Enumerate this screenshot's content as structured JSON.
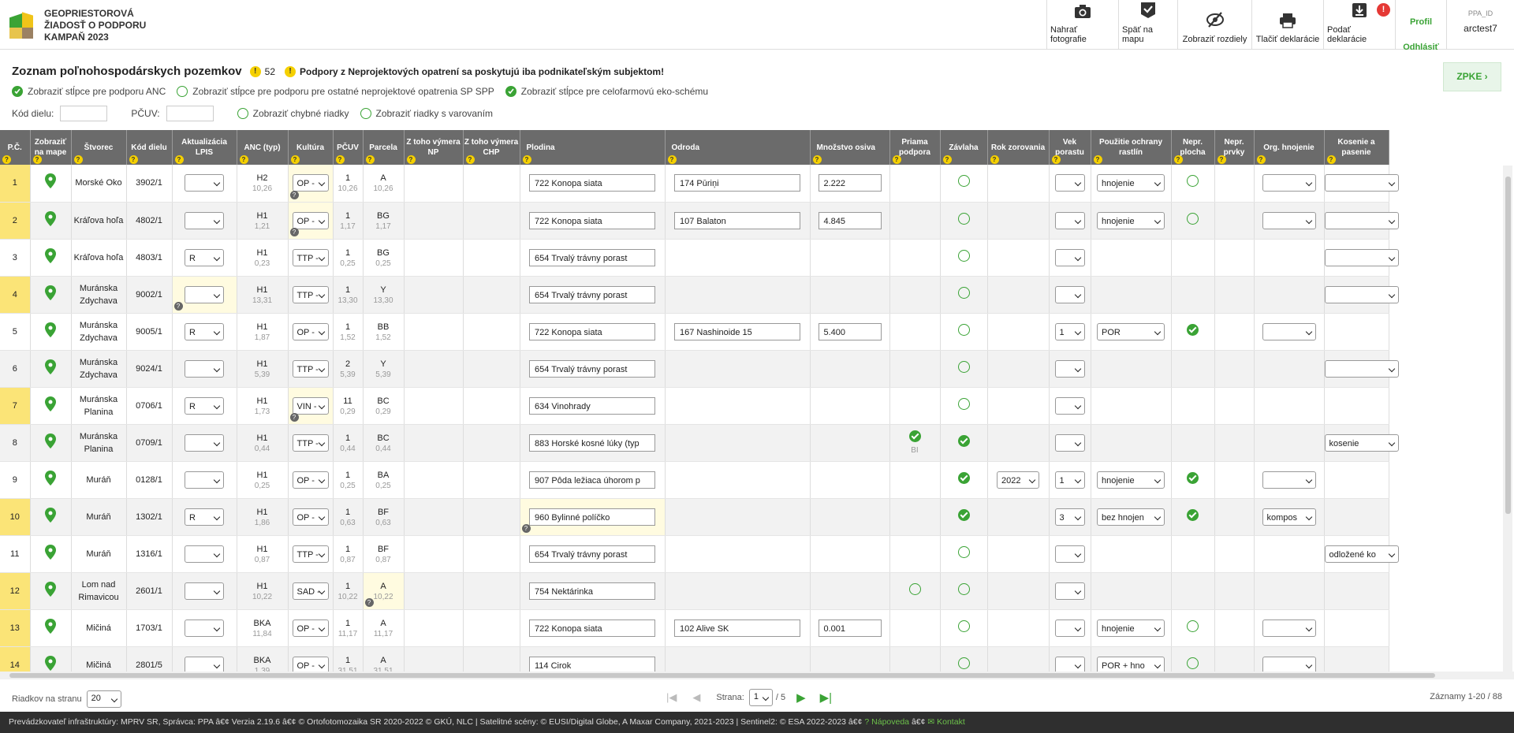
{
  "header": {
    "brand_lines": [
      "GEOPRIESTOROVÁ",
      "ŽIADOSŤ O PODPORU",
      "KAMPAŇ 2023"
    ],
    "toolbar": [
      {
        "label": "Nahrať fotografie",
        "icon": "camera-icon"
      },
      {
        "label": "Späť na mapu",
        "icon": "map-check-icon"
      },
      {
        "label": "Zobraziť rozdiely",
        "icon": "eye-off-icon"
      },
      {
        "label": "Tlačiť deklarácie",
        "icon": "printer-icon"
      },
      {
        "label": "Podať deklarácie",
        "icon": "submit-icon",
        "badge": "!"
      }
    ],
    "profile": "Profil",
    "logout": "Odhlásiť",
    "ppa_label": "PPA_ID",
    "ppa_value": "arctest7"
  },
  "title": {
    "text": "Zoznam poľnohospodárskych pozemkov",
    "count": "52",
    "warning": "Podpory z Neprojektových opatrení sa poskytujú iba podnikateľským subjektom!"
  },
  "zpke": "ZPKE",
  "checks": [
    {
      "label": "Zobraziť stĺpce pre podporu ANC",
      "on": true
    },
    {
      "label": "Zobraziť stĺpce pre podporu pre ostatné neprojektové opatrenia SP SPP",
      "on": false
    },
    {
      "label": "Zobraziť stĺpce pre celofarmovú eko-schému",
      "on": true
    }
  ],
  "filters": {
    "kod_label": "Kód dielu:",
    "pcuv_label": "PČUV:",
    "chybne": "Zobraziť chybné riadky",
    "varovanie": "Zobraziť riadky s varovaním"
  },
  "columns": [
    "P.Č.",
    "Zobraziť na mape",
    "Štvorec",
    "Kód dielu",
    "Aktualizácia LPIS",
    "ANC (typ)",
    "Kultúra",
    "PČUV",
    "Parcela",
    "Z toho výmera NP",
    "Z toho výmera CHP",
    "Plodina",
    "Odroda",
    "Množstvo osiva",
    "Priama podpora",
    "Závlaha",
    "Rok zorovania",
    "Vek porastu",
    "Použitie ochrany rastlín",
    "Nepr. plocha",
    "Nepr. prvky",
    "Org. hnojenie",
    "Kosenie a pasenie"
  ],
  "rows": [
    {
      "pc": "1",
      "y": true,
      "stvorec": "Morské Oko",
      "kod": "3902/1",
      "lpis": "",
      "anc": "H2",
      "anc_sub": "10,26",
      "kultura": "OP -",
      "kult_hl": true,
      "pcuv": "1",
      "pcuv_sub": "10,26",
      "parcela": "A",
      "par_sub": "10,26",
      "plodina": "722  Konopa siata",
      "odroda": "174  Pūriņi",
      "osivo": "2.222",
      "zavlaha": "off",
      "vek": "",
      "ochrana": "hnojenie",
      "nepr": "off",
      "org": "",
      "kos": ""
    },
    {
      "pc": "2",
      "y": true,
      "stvorec": "Kráľova hoľa",
      "kod": "4802/1",
      "lpis": "",
      "anc": "H1",
      "anc_sub": "1,21",
      "kultura": "OP -",
      "kult_hl": true,
      "pcuv": "1",
      "pcuv_sub": "1,17",
      "parcela": "BG",
      "par_sub": "1,17",
      "plodina": "722  Konopa siata",
      "odroda": "107  Balaton",
      "osivo": "4.845",
      "zavlaha": "off",
      "vek": "",
      "ochrana": "hnojenie",
      "nepr": "off",
      "org": "",
      "kos": ""
    },
    {
      "pc": "3",
      "y": false,
      "stvorec": "Kráľova hoľa",
      "kod": "4803/1",
      "lpis": "R",
      "anc": "H1",
      "anc_sub": "0,23",
      "kultura": "TTP -",
      "pcuv": "1",
      "pcuv_sub": "0,25",
      "parcela": "BG",
      "par_sub": "0,25",
      "plodina": "654  Trvalý trávny porast",
      "zavlaha": "off",
      "vek": "",
      "kos": ""
    },
    {
      "pc": "4",
      "y": true,
      "stvorec": "Muránska Zdychava",
      "kod": "9002/1",
      "lpis": "",
      "lpis_hl": true,
      "anc": "H1",
      "anc_sub": "13,31",
      "kultura": "TTP -",
      "pcuv": "1",
      "pcuv_sub": "13,30",
      "parcela": "Y",
      "par_sub": "13,30",
      "plodina": "654  Trvalý trávny porast",
      "zavlaha": "off",
      "vek": "",
      "kos": ""
    },
    {
      "pc": "5",
      "y": false,
      "stvorec": "Muránska Zdychava",
      "kod": "9005/1",
      "lpis": "R",
      "anc": "H1",
      "anc_sub": "1,87",
      "kultura": "OP -",
      "pcuv": "1",
      "pcuv_sub": "1,52",
      "parcela": "BB",
      "par_sub": "1,52",
      "plodina": "722  Konopa siata",
      "odroda": "167  Nashinoide 15",
      "osivo": "5.400",
      "zavlaha": "off",
      "vek": "1",
      "ochrana": "POR",
      "nepr": "on",
      "org": ""
    },
    {
      "pc": "6",
      "y": false,
      "stvorec": "Muránska Zdychava",
      "kod": "9024/1",
      "lpis": "",
      "anc": "H1",
      "anc_sub": "5,39",
      "kultura": "TTP -",
      "pcuv": "2",
      "pcuv_sub": "5,39",
      "parcela": "Y",
      "par_sub": "5,39",
      "plodina": "654  Trvalý trávny porast",
      "zavlaha": "off",
      "vek": "",
      "kos": ""
    },
    {
      "pc": "7",
      "y": true,
      "stvorec": "Muránska Planina",
      "kod": "0706/1",
      "lpis": "R",
      "anc": "H1",
      "anc_sub": "1,73",
      "kultura": "VIN -",
      "kult_hl": true,
      "pcuv": "11",
      "pcuv_sub": "0,29",
      "parcela": "BC",
      "par_sub": "0,29",
      "plodina": "634  Vinohrady",
      "zavlaha": "off",
      "vek": ""
    },
    {
      "pc": "8",
      "y": false,
      "stvorec": "Muránska Planina",
      "kod": "0709/1",
      "lpis": "",
      "anc": "H1",
      "anc_sub": "0,44",
      "kultura": "TTP -",
      "pcuv": "1",
      "pcuv_sub": "0,44",
      "parcela": "BC",
      "par_sub": "0,44",
      "plodina": "883  Horské kosné lúky (typ",
      "priama": "BI",
      "zavlaha": "on",
      "vek": "",
      "kos": "kosenie"
    },
    {
      "pc": "9",
      "y": false,
      "stvorec": "Muráň",
      "kod": "0128/1",
      "lpis": "",
      "anc": "H1",
      "anc_sub": "0,25",
      "kultura": "OP -",
      "pcuv": "1",
      "pcuv_sub": "0,25",
      "parcela": "BA",
      "par_sub": "0,25",
      "plodina": "907  Pôda ležiaca úhorom p",
      "zavlaha": "on",
      "rok": "2022",
      "vek": "1",
      "ochrana": "hnojenie",
      "nepr": "on",
      "org": ""
    },
    {
      "pc": "10",
      "y": true,
      "stvorec": "Muráň",
      "kod": "1302/1",
      "lpis": "R",
      "anc": "H1",
      "anc_sub": "1,86",
      "kultura": "OP -",
      "pcuv": "1",
      "pcuv_sub": "0,63",
      "parcela": "BF",
      "par_sub": "0,63",
      "plodina": "960  Bylinné políčko",
      "plod_hl": true,
      "zavlaha": "on",
      "vek": "3",
      "ochrana": "bez hnojen",
      "nepr": "on",
      "org": "kompos"
    },
    {
      "pc": "11",
      "y": false,
      "stvorec": "Muráň",
      "kod": "1316/1",
      "lpis": "",
      "anc": "H1",
      "anc_sub": "0,87",
      "kultura": "TTP -",
      "pcuv": "1",
      "pcuv_sub": "0,87",
      "parcela": "BF",
      "par_sub": "0,87",
      "plodina": "654  Trvalý trávny porast",
      "zavlaha": "off",
      "vek": "",
      "kos": "odložené ko"
    },
    {
      "pc": "12",
      "y": true,
      "stvorec": "Lom nad Rimavicou",
      "kod": "2601/1",
      "lpis": "",
      "anc": "H1",
      "anc_sub": "10,22",
      "kultura": "SAD -",
      "pcuv": "1",
      "pcuv_sub": "10,22",
      "parcela": "A",
      "par_sub": "10,22",
      "par_hl": true,
      "plodina": "754  Nektárinka",
      "priama": "off",
      "zavlaha": "off",
      "vek": ""
    },
    {
      "pc": "13",
      "y": true,
      "stvorec": "Mičiná",
      "kod": "1703/1",
      "lpis": "",
      "anc": "BKA",
      "anc_sub": "11,84",
      "kultura": "OP -",
      "pcuv": "1",
      "pcuv_sub": "11,17",
      "parcela": "A",
      "par_sub": "11,17",
      "plodina": "722  Konopa siata",
      "odroda": "102  Alive SK",
      "osivo": "0.001",
      "zavlaha": "off",
      "vek": "",
      "ochrana": "hnojenie",
      "nepr": "off",
      "org": ""
    },
    {
      "pc": "14",
      "y": true,
      "stvorec": "Mičiná",
      "kod": "2801/5",
      "lpis": "",
      "anc": "BKA",
      "anc_sub": "1,39",
      "kultura": "OP -",
      "pcuv": "1",
      "pcuv_sub": "31,51",
      "parcela": "A",
      "par_sub": "31,51",
      "plodina": "114  Cirok",
      "zavlaha": "off",
      "vek": "",
      "ochrana": "POR + hno",
      "nepr": "off",
      "org": ""
    }
  ],
  "pager": {
    "rows_label": "Riadkov na stranu",
    "rows_value": "20",
    "page_label": "Strana:",
    "page_value": "1",
    "page_total": "/ 5",
    "records": "Záznamy 1-20 / 88"
  },
  "footer": {
    "text": "Prevádzkovateľ infraštruktúry: MPRV SR, Správca: PPA â€¢ Verzia 2.19.6 â€¢ © Ortofotomozaika SR 2020-2022 © GKÚ, NLC | Satelitné scény: © EUSI/Digital Globe, A Maxar Company, 2021-2023 | Sentinel2: © ESA 2022-2023 â€¢",
    "help": "Nápoveda",
    "sep": "â€¢",
    "contact": "Kontakt"
  },
  "colors": {
    "green": "#3aa335",
    "yellow": "#fbe477",
    "header_gray": "#6b6b6b"
  }
}
